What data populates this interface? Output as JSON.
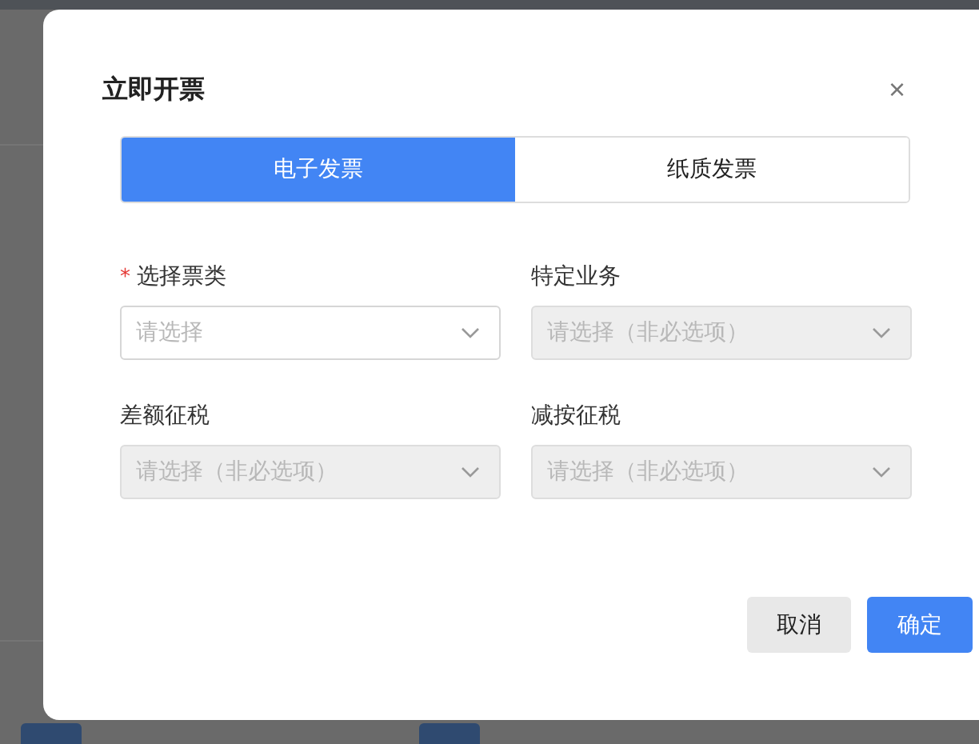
{
  "dialog": {
    "title": "立即开票",
    "close": "×"
  },
  "tabs": [
    {
      "label": "电子发票",
      "selected": true
    },
    {
      "label": "纸质发票",
      "selected": false
    }
  ],
  "fields": [
    {
      "label": "选择票类",
      "marker": "*",
      "placeholder": "请选择",
      "disabled": false
    },
    {
      "label": "特定业务",
      "placeholder": "请选择（非必选项）",
      "disabled": true
    },
    {
      "label": "差额征税",
      "placeholder": "请选择（非必选项）",
      "disabled": true
    },
    {
      "label": "减按征税",
      "placeholder": "请选择（非必选项）",
      "disabled": true
    }
  ],
  "buttons": [
    {
      "label": "取消",
      "kind": "secondary"
    },
    {
      "label": "确定",
      "kind": "primary"
    }
  ]
}
